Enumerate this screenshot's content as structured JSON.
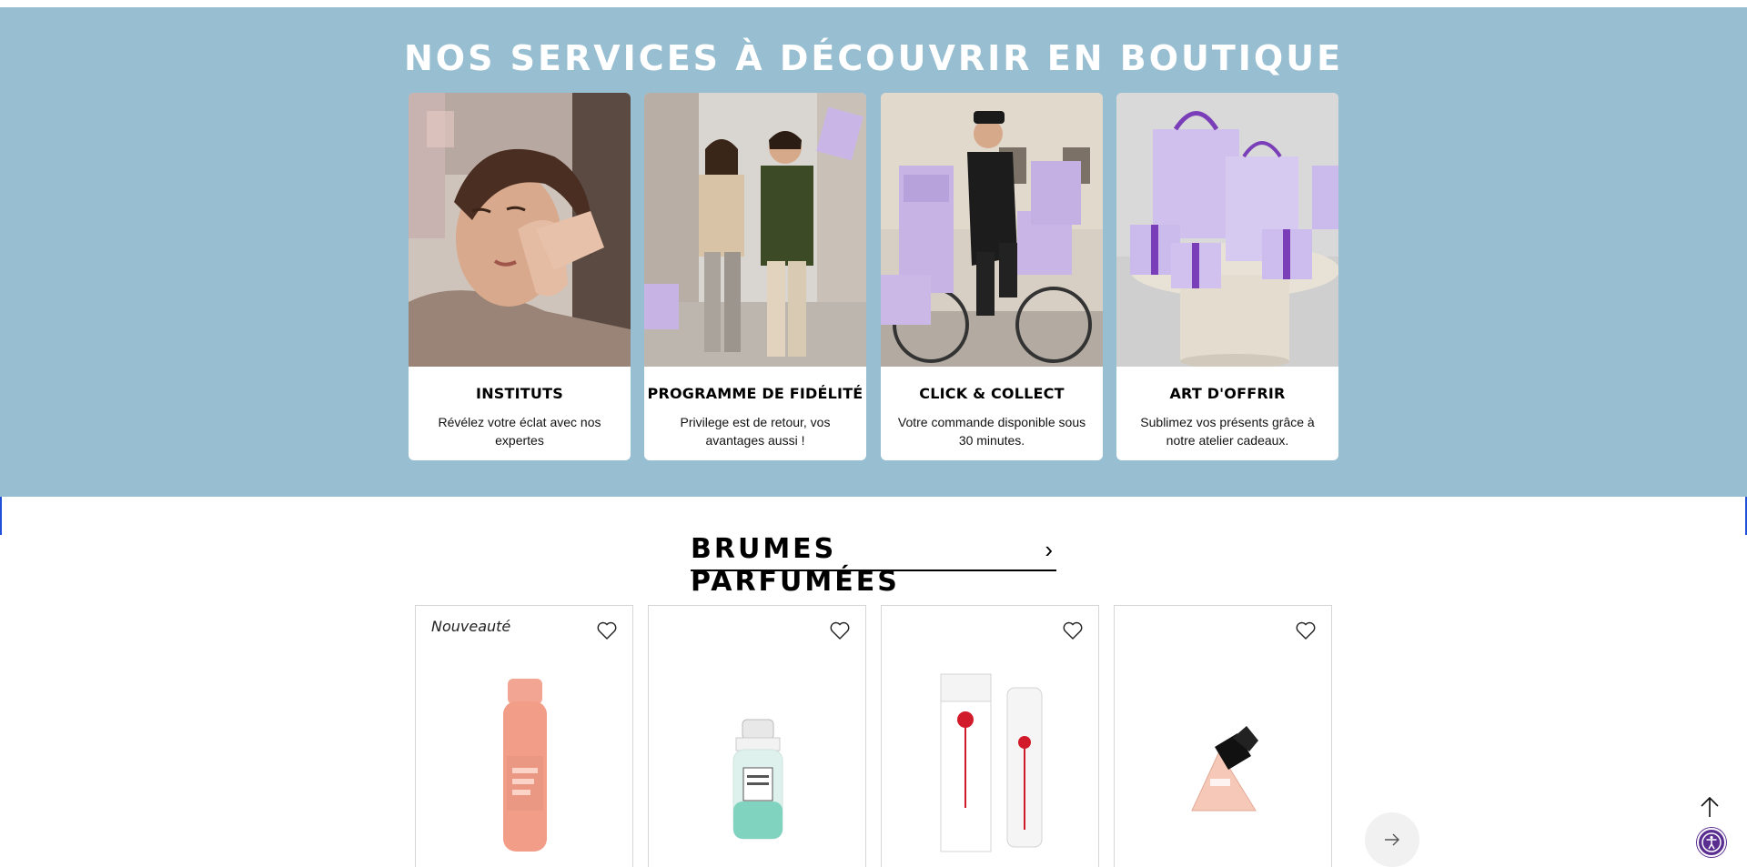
{
  "services": {
    "title": "NOS SERVICES À DÉCOUVRIR EN BOUTIQUE",
    "cards": [
      {
        "name": "INSTITUTS",
        "desc": "Révélez votre éclat avec nos expertes"
      },
      {
        "name": "PROGRAMME DE FIDÉLITÉ",
        "desc": "Privilege est de retour, vos avantages aussi !"
      },
      {
        "name": "CLICK & COLLECT",
        "desc": "Votre commande disponible sous 30 minutes."
      },
      {
        "name": "ART D'OFFRIR",
        "desc": "Sublimez vos présents grâce à notre atelier cadeaux."
      }
    ]
  },
  "products_section": {
    "title": "BRUMES PARFUMÉES",
    "chevron": "›",
    "products": [
      {
        "badge": "Nouveauté"
      },
      {
        "badge": ""
      },
      {
        "badge": ""
      },
      {
        "badge": ""
      }
    ]
  },
  "colors": {
    "services_bg": "#97bed1",
    "accent_purple": "#5a2d91"
  },
  "icons": {
    "wishlist": "heart-icon",
    "next": "arrow-right-icon",
    "scroll_top": "arrow-up-icon",
    "accessibility": "accessibility-icon"
  }
}
